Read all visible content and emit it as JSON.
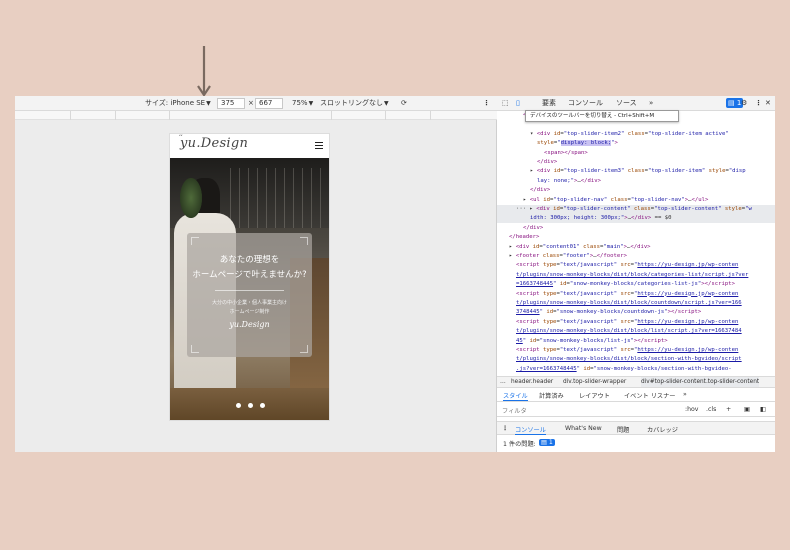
{
  "device_toolbar": {
    "device_select": "サイズ: iPhone SE",
    "width": "375",
    "times": "×",
    "height": "667",
    "zoom": "75%",
    "throttling": "スロットリングなし"
  },
  "website": {
    "logo": "yu.Design",
    "logo_mark": "‘‘",
    "hero_heading_line1": "あなたの理想を",
    "hero_heading_line2": "ホームページで叶えませんか?",
    "hero_sub_line1": "大分の中小企業・個人事業主向け",
    "hero_sub_line2": "ホームページ制作",
    "hero_logo": "yu.Design",
    "slider_dots": 3
  },
  "devtools": {
    "tabs": [
      "要素",
      "コンソール",
      "ソース"
    ],
    "more_tabs": "»",
    "issues_badge": "1",
    "tooltip": "デバイスのツールバーを切り替え - Ctrl+Shift+M",
    "dom_lines": [
      {
        "indent": 0,
        "html": "<span class='tag'>&lt;div</span> <span class='attr'>id</span>=<span class='val'>\"top-slider-item\"</span> <span class='attr'>style</span>=<span class='val'>\"disp</span>"
      },
      {
        "indent": 0,
        "html": "&nbsp;&nbsp;&nbsp;&nbsp;&nbsp;&nbsp;&nbsp;&nbsp;&nbsp;&nbsp;&nbsp;&nbsp;&nbsp;&nbsp;&nbsp;&nbsp;&nbsp;&nbsp;&nbsp;&nbsp;&nbsp;&nbsp;&nbsp;&nbsp;&nbsp;&nbsp;&nbsp;&nbsp;&nbsp;&nbsp;&nbsp;&nbsp;&nbsp;&nbsp;&nbsp;&nbsp;&nbsp;&nbsp;"
      },
      {
        "indent": 1,
        "html": "▾ <span class='tag'>&lt;div</span> <span class='attr'>id</span>=<span class='val'>\"top-slider-item2\"</span> <span class='attr'>class</span>=<span class='val'>\"top-slider-item active\"</span>"
      },
      {
        "indent": 2,
        "html": "<span class='attr'>style</span>=<span class='val'>\"<span class='hl'>display: block;</span>\"</span><span class='tag'>&gt;</span>"
      },
      {
        "indent": 3,
        "html": "<span class='tag'>&lt;span&gt;&lt;/span&gt;</span>"
      },
      {
        "indent": 2,
        "html": "<span class='tag'>&lt;/div&gt;</span>"
      },
      {
        "indent": 1,
        "html": "▸ <span class='tag'>&lt;div</span> <span class='attr'>id</span>=<span class='val'>\"top-slider-item3\"</span> <span class='attr'>class</span>=<span class='val'>\"top-slider-item\"</span> <span class='attr'>style</span>=<span class='val'>\"disp</span>"
      },
      {
        "indent": 2,
        "html": "<span class='val'>lay: none;\"</span><span class='tag'>&gt;</span>…<span class='tag'>&lt;/div&gt;</span>"
      },
      {
        "indent": 1,
        "html": "<span class='tag'>&lt;/div&gt;</span>"
      },
      {
        "indent": 0,
        "html": "▸ <span class='tag'>&lt;ul</span> <span class='attr'>id</span>=<span class='val'>\"top-slider-nav\"</span> <span class='attr'>class</span>=<span class='val'>\"top-slider-nav\"</span><span class='tag'>&gt;</span>…<span class='tag'>&lt;/ul&gt;</span>"
      },
      {
        "indent": -1,
        "html": "··· ▸ <span class='tag'>&lt;div</span> <span class='attr'>id</span>=<span class='val'>\"top-slider-content\"</span> <span class='attr'>class</span>=<span class='val'>\"top-slider-content\"</span> <span class='attr'>style</span>=<span class='val'>\"w</span>"
      },
      {
        "indent": 1,
        "html": "<span class='val'>idth: 300px; height: 300px;\"</span><span class='tag'>&gt;</span>…<span class='tag'>&lt;/div&gt;</span> == $0"
      },
      {
        "indent": 0,
        "html": "<span class='tag'>&lt;/div&gt;</span>"
      },
      {
        "indent": -2,
        "html": "<span class='tag'>&lt;/header&gt;</span>"
      },
      {
        "indent": -2,
        "html": "▸ <span class='tag'>&lt;div</span> <span class='attr'>id</span>=<span class='val'>\"content01\"</span> <span class='attr'>class</span>=<span class='val'>\"main\"</span><span class='tag'>&gt;</span>…<span class='tag'>&lt;/div&gt;</span>"
      },
      {
        "indent": -2,
        "html": "▸ <span class='tag'>&lt;footer</span> <span class='attr'>class</span>=<span class='val'>\"footer\"</span><span class='tag'>&gt;</span>…<span class='tag'>&lt;/footer&gt;</span>"
      },
      {
        "indent": -1,
        "html": "<span class='tag'>&lt;script</span> <span class='attr'>type</span>=<span class='val'>\"text/javascript\"</span> <span class='attr'>src</span>=<span class='val'>\"<span class='lnk'>https://yu-design.jp/wp-conten</span></span>"
      },
      {
        "indent": -1,
        "html": "<span class='lnk'>t/plugins/snow-monkey-blocks/dist/block/categories-list/script.js?ver</span>"
      },
      {
        "indent": -1,
        "html": "<span class='lnk'>=1663748445</span><span class='val'>\"</span> <span class='attr'>id</span>=<span class='val'>\"snow-monkey-blocks/categories-list-js\"</span><span class='tag'>&gt;&lt;/script&gt;</span>"
      },
      {
        "indent": -1,
        "html": "<span class='tag'>&lt;script</span> <span class='attr'>type</span>=<span class='val'>\"text/javascript\"</span> <span class='attr'>src</span>=<span class='val'>\"<span class='lnk'>https://yu-design.jp/wp-conten</span></span>"
      },
      {
        "indent": -1,
        "html": "<span class='lnk'>t/plugins/snow-monkey-blocks/dist/block/countdown/script.js?ver=166</span>"
      },
      {
        "indent": -1,
        "html": "<span class='lnk'>3748445</span><span class='val'>\"</span> <span class='attr'>id</span>=<span class='val'>\"snow-monkey-blocks/countdown-js\"</span><span class='tag'>&gt;&lt;/script&gt;</span>"
      },
      {
        "indent": -1,
        "html": "<span class='tag'>&lt;script</span> <span class='attr'>type</span>=<span class='val'>\"text/javascript\"</span> <span class='attr'>src</span>=<span class='val'>\"<span class='lnk'>https://yu-design.jp/wp-conten</span></span>"
      },
      {
        "indent": -1,
        "html": "<span class='lnk'>t/plugins/snow-monkey-blocks/dist/block/list/script.js?ver=16637484</span>"
      },
      {
        "indent": -1,
        "html": "<span class='lnk'>45</span><span class='val'>\"</span> <span class='attr'>id</span>=<span class='val'>\"snow-monkey-blocks/list-js\"</span><span class='tag'>&gt;&lt;/script&gt;</span>"
      },
      {
        "indent": -1,
        "html": "<span class='tag'>&lt;script</span> <span class='attr'>type</span>=<span class='val'>\"text/javascript\"</span> <span class='attr'>src</span>=<span class='val'>\"<span class='lnk'>https://yu-design.jp/wp-conten</span></span>"
      },
      {
        "indent": -1,
        "html": "<span class='lnk'>t/plugins/snow-monkey-blocks/dist/block/section-with-bgvideo/script</span>"
      },
      {
        "indent": -1,
        "html": "<span class='lnk'>.js?ver=1663748445</span><span class='val'>\"</span> <span class='attr'>id</span>=<span class='val'>\"snow-monkey-blocks/section-with-bgvideo-</span>"
      }
    ],
    "breadcrumbs": [
      "header.header",
      "div.top-slider-wrapper",
      "div#top-slider-content.top-slider-content"
    ],
    "breadcrumb_ellipsis": "…",
    "styles_tabs": [
      "スタイル",
      "計算済み",
      "レイアウト",
      "イベント リスナー",
      "»"
    ],
    "filter_placeholder": "フィルタ",
    "filter_tools": [
      ":hov",
      ".cls",
      "+"
    ],
    "drawer_tabs": [
      "コンソール",
      "What's New",
      "問題",
      "カバレッジ"
    ],
    "issues_text": "1 件の問題:",
    "issues_count": "1"
  },
  "colors": {
    "background": "#e8cfc2",
    "accent": "#1a73e8",
    "tag": "#881280",
    "attr": "#994500",
    "value": "#1a1aa6"
  }
}
